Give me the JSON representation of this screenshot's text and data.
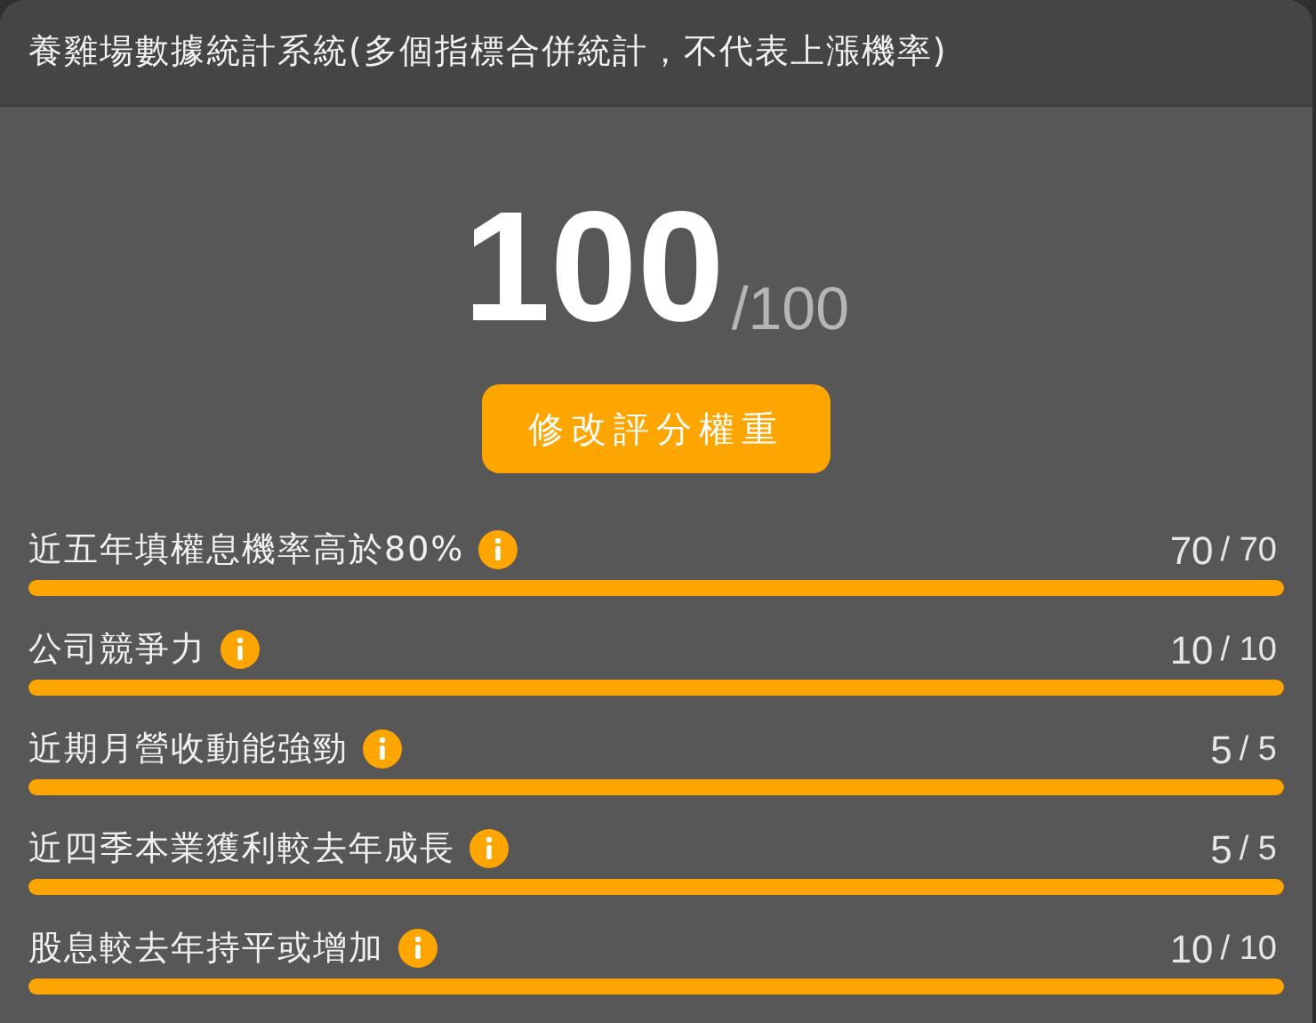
{
  "window": {
    "title": "養雞場數據統計系統(多個指標合併統計，不代表上漲機率)"
  },
  "total": {
    "score": "100",
    "max": "/100"
  },
  "edit_button": "修改評分權重",
  "criteria": [
    {
      "label": "近五年填權息機率高於80%",
      "score": "70",
      "max": "/ 70",
      "level": 1
    },
    {
      "label": "公司競爭力",
      "score": "10",
      "max": "/ 10",
      "level": 1
    },
    {
      "label": "近期月營收動能強勁",
      "score": "5",
      "max": "/ 5",
      "level": 1
    },
    {
      "label": "近四季本業獲利較去年成長",
      "score": "5",
      "max": "/ 5",
      "level": 1
    },
    {
      "label": "股息較去年持平或增加",
      "score": "10",
      "max": "/ 10",
      "level": 1
    }
  ]
}
